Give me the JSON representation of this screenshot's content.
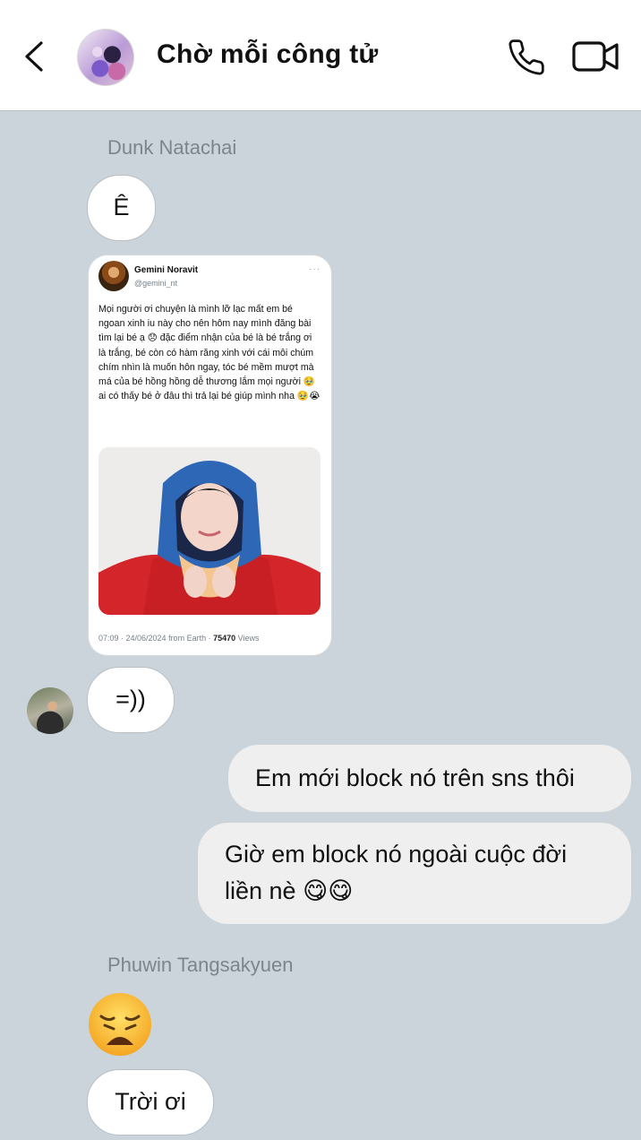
{
  "header": {
    "title": "Chờ mỗi công tử",
    "back_icon": "chevron-left-icon",
    "call_icon": "phone-icon",
    "video_icon": "video-camera-icon"
  },
  "messages": {
    "m1_sender": "Dunk Natachai",
    "m1_text": "Ê",
    "tweet": {
      "name": "Gemini Noravit",
      "handle": "@gemini_nt",
      "text": "Mọi người ơi chuyện là mình lỡ lạc mất em bé ngoan xinh iu này cho nên hôm nay mình đăng bài tìm lại bé ạ 😞 đặc điểm nhận của bé là bé trắng ơi là trắng, bé còn có hàm răng xinh với cái môi chúm chím nhìn là muốn hôn ngay, tóc bé mềm mượt mà má của bé hồng hồng dễ thương lắm mọi người 🥹 ai có thấy bé ở đâu thì trả lại bé giúp mình nha 🥹😭",
      "meta_time": "07:09 · 24/06/2024 from Earth · ",
      "meta_views": "75470",
      "meta_views_label": " Views"
    },
    "m2_text": "=))",
    "out1_text": "Em mới block nó trên sns thôi",
    "out2_text": "Giờ em block nó ngoài cuộc đời liền nè 😋😋",
    "m3_sender": "Phuwin Tangsakyuen",
    "m3_emoji": "weary-face-emoji",
    "m4_text": "Trời ơi"
  },
  "colors": {
    "chat_background": "#ccd4db",
    "incoming_bubble": "#ffffff",
    "outgoing_bubble": "#efefef",
    "sender_name": "#7c858c"
  }
}
